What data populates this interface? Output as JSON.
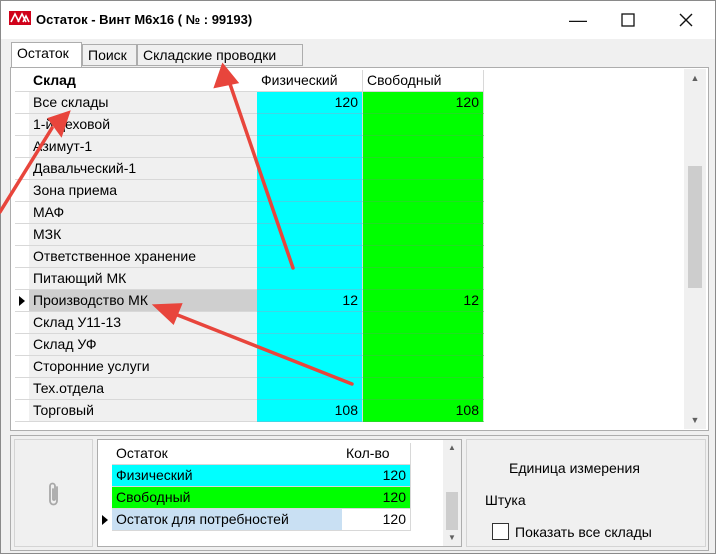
{
  "window": {
    "title": "Остаток - Винт М6х16 ( № : 99193)"
  },
  "tabs": [
    {
      "label": "Остаток",
      "active": true
    },
    {
      "label": "Поиск",
      "active": false
    },
    {
      "label": "Складские проводки",
      "active": false
    }
  ],
  "main_grid": {
    "headers": [
      "Склад",
      "Физический",
      "Свободный"
    ],
    "rows": [
      {
        "name": "Все склады",
        "physical": "120",
        "free": "120"
      },
      {
        "name": "1-й цеховой",
        "physical": "",
        "free": ""
      },
      {
        "name": "Азимут-1",
        "physical": "",
        "free": ""
      },
      {
        "name": "Давальческий-1",
        "physical": "",
        "free": ""
      },
      {
        "name": "Зона приема",
        "physical": "",
        "free": ""
      },
      {
        "name": "МАФ",
        "physical": "",
        "free": ""
      },
      {
        "name": "МЗК",
        "physical": "",
        "free": ""
      },
      {
        "name": "Ответственное хранение",
        "physical": "",
        "free": ""
      },
      {
        "name": "Питающий МК",
        "physical": "",
        "free": ""
      },
      {
        "name": "Производство МК",
        "physical": "12",
        "free": "12",
        "selected": true
      },
      {
        "name": "Склад У11-13",
        "physical": "",
        "free": ""
      },
      {
        "name": "Склад УФ",
        "physical": "",
        "free": ""
      },
      {
        "name": "Сторонние услуги",
        "physical": "",
        "free": ""
      },
      {
        "name": "Тех.отдела",
        "physical": "",
        "free": ""
      },
      {
        "name": "Торговый",
        "physical": "108",
        "free": "108"
      }
    ]
  },
  "summary_grid": {
    "headers": [
      "Остаток",
      "Кол-во"
    ],
    "rows": [
      {
        "label": "Физический",
        "value": "120"
      },
      {
        "label": "Свободный",
        "value": "120"
      },
      {
        "label": "Остаток для потребностей",
        "value": "120"
      }
    ]
  },
  "unit": {
    "label": "Единица измерения",
    "value": "Штука"
  },
  "show_all_checkbox": {
    "label": "Показать все склады",
    "checked": false
  },
  "colors": {
    "physical": "#00ffff",
    "free": "#00ff00",
    "selection": "#cfcfcf",
    "annotation_arrow": "#e8453c"
  },
  "icons": [
    "app-logo-icon",
    "minimize-icon",
    "maximize-icon",
    "close-icon",
    "row-pointer-icon",
    "paperclip-icon",
    "scroll-up-icon",
    "scroll-down-icon"
  ]
}
